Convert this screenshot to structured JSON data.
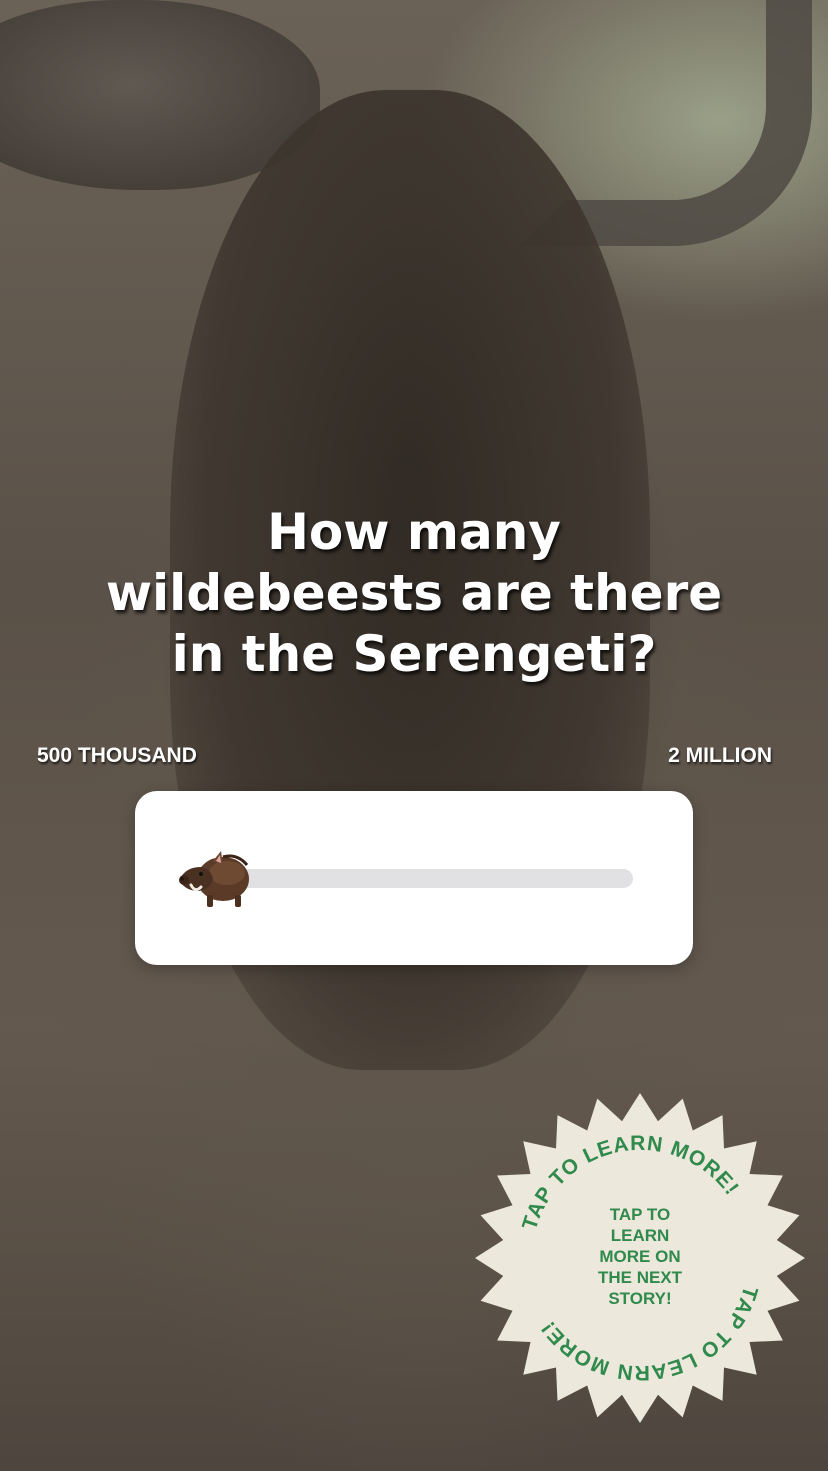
{
  "question": {
    "line1": "How many",
    "line2": "wildebeests are there",
    "line3": "in the Serengeti?"
  },
  "slider": {
    "min_label": "500 THOUSAND",
    "max_label": "2 MILLION",
    "thumb_icon": "boar-emoji-icon",
    "value": 0
  },
  "sticker": {
    "ring_text": "TAP TO LEARN MORE!",
    "center_line1": "TAP TO",
    "center_line2": "LEARN",
    "center_line3": "MORE ON",
    "center_line4": "THE NEXT",
    "center_line5": "STORY!",
    "fill_color": "#ede8dc",
    "text_color": "#2f8a4c"
  }
}
